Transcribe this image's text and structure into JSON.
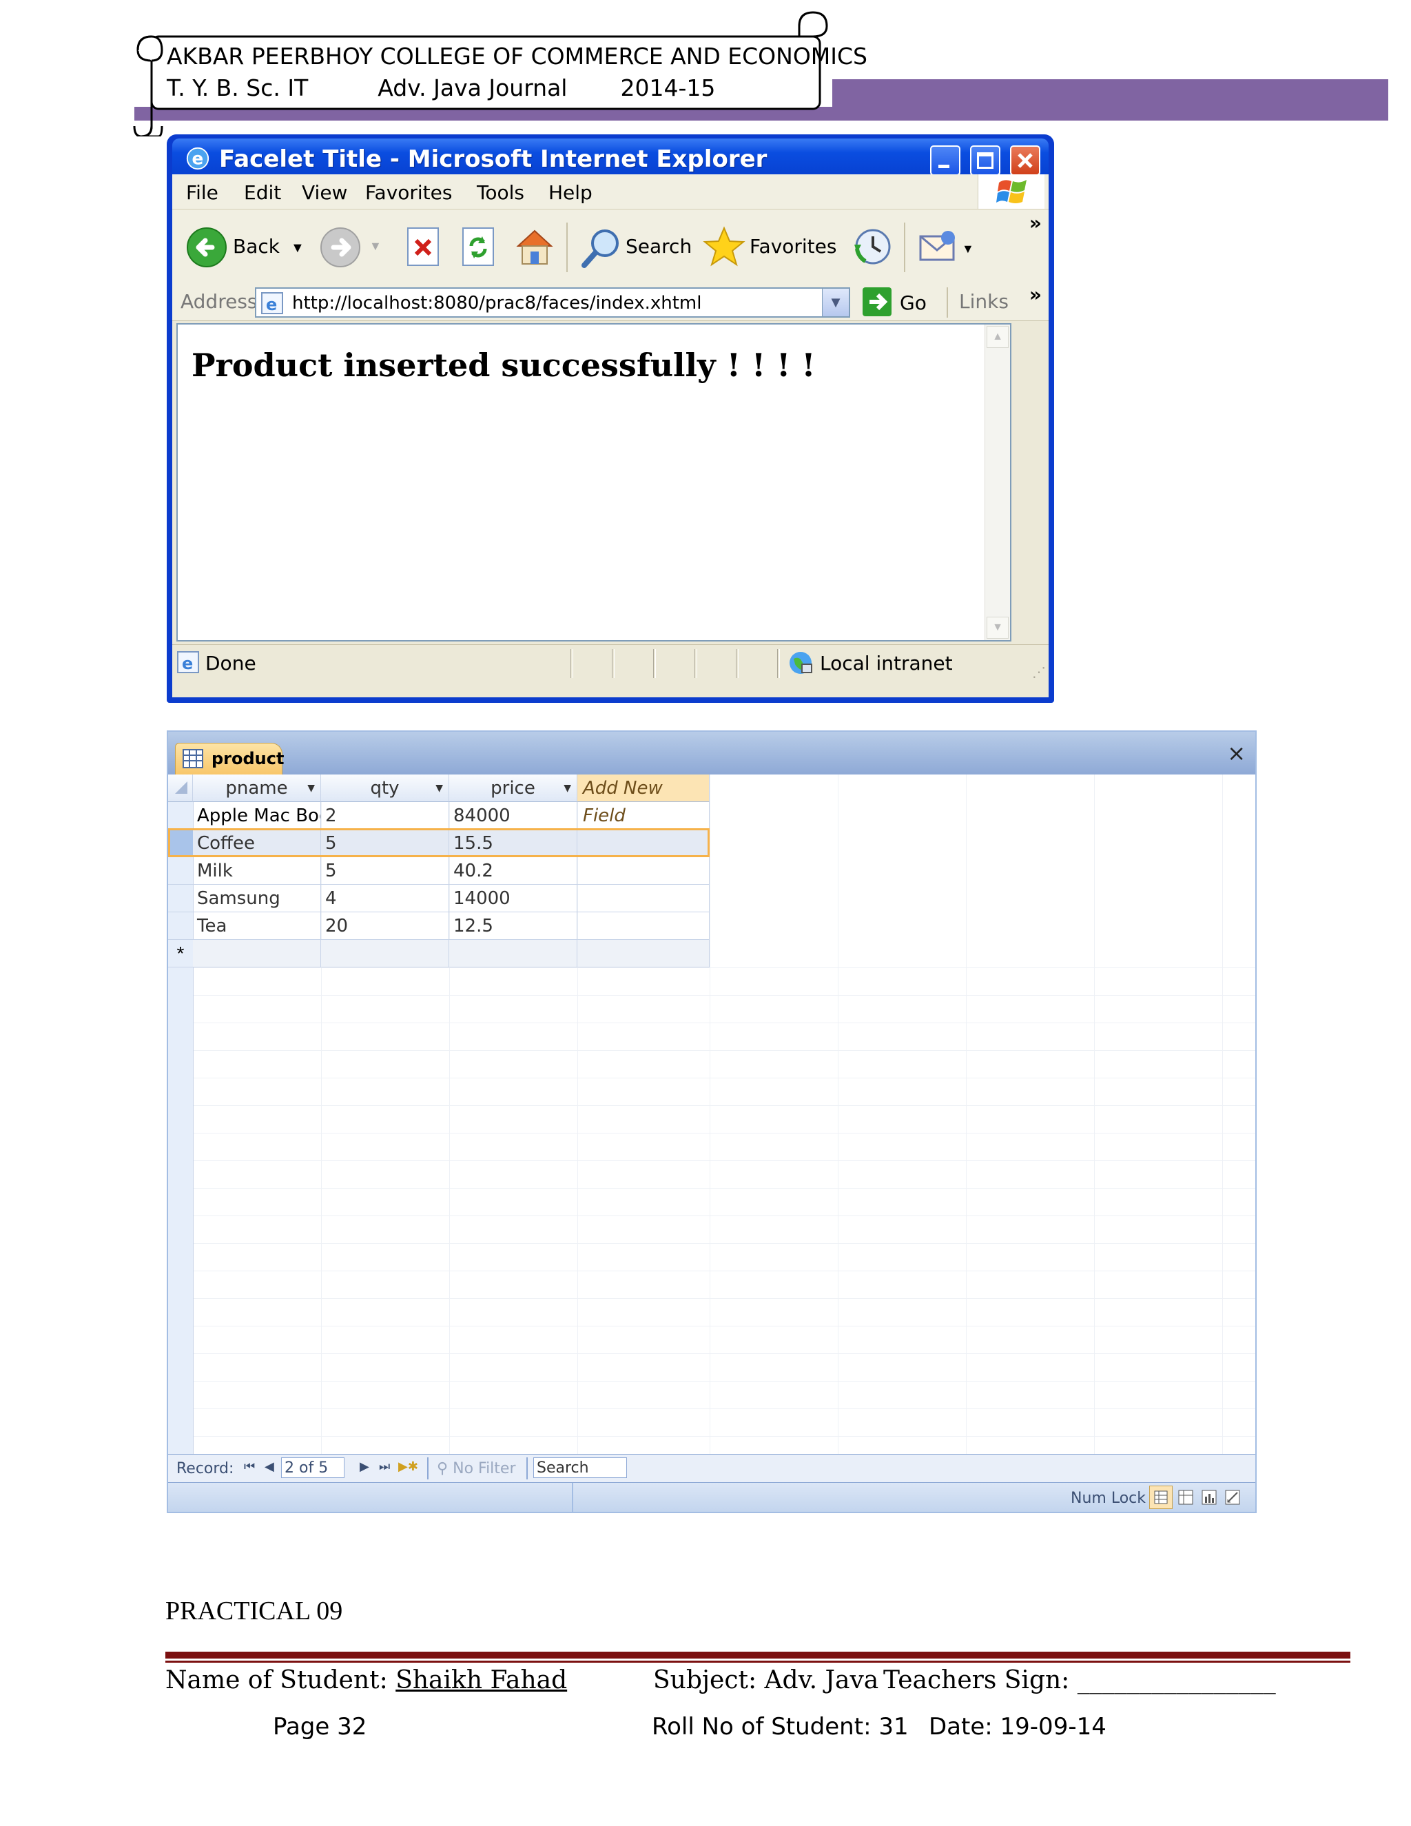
{
  "header": {
    "line1": "AKBAR PEERBHOY COLLEGE OF COMMERCE AND ECONOMICS",
    "class": "T. Y. B. Sc. IT",
    "journal": "Adv. Java Journal",
    "year": "2014-15"
  },
  "browser": {
    "title": "Facelet Title - Microsoft Internet Explorer",
    "menu": [
      "File",
      "Edit",
      "View",
      "Favorites",
      "Tools",
      "Help"
    ],
    "toolbar": {
      "back": "Back",
      "search": "Search",
      "favorites": "Favorites",
      "more": "»"
    },
    "address_label": "Address",
    "address": "http://localhost:8080/prac8/faces/index.xhtml",
    "go": "Go",
    "links": "Links",
    "message": "Product inserted successfully ! ! ! !",
    "status": "Done",
    "zone": "Local intranet"
  },
  "access": {
    "tab": "product",
    "close": "×",
    "columns": [
      "pname",
      "qty",
      "price",
      "Add New Field"
    ],
    "rows": [
      [
        "Apple Mac Boo",
        "2",
        "84000"
      ],
      [
        "Coffee",
        "5",
        "15.5"
      ],
      [
        "Milk",
        "5",
        "40.2"
      ],
      [
        "Samsung",
        "4",
        "14000"
      ],
      [
        "Tea",
        "20",
        "12.5"
      ]
    ],
    "new_row_marker": "*",
    "record_label": "Record:",
    "record_pos": "2 of 5",
    "no_filter": "No Filter",
    "search": "Search",
    "num_lock": "Num Lock"
  },
  "footer": {
    "practical": "PRACTICAL 09",
    "student_label": "Name of Student:",
    "student_name": "Shaikh Fahad",
    "subject": "Subject: Adv. Java",
    "teacher_sign": "Teachers Sign: ________________",
    "page": "Page 32",
    "roll": "Roll No of Student: 31",
    "date": "Date: 19-09-14"
  }
}
